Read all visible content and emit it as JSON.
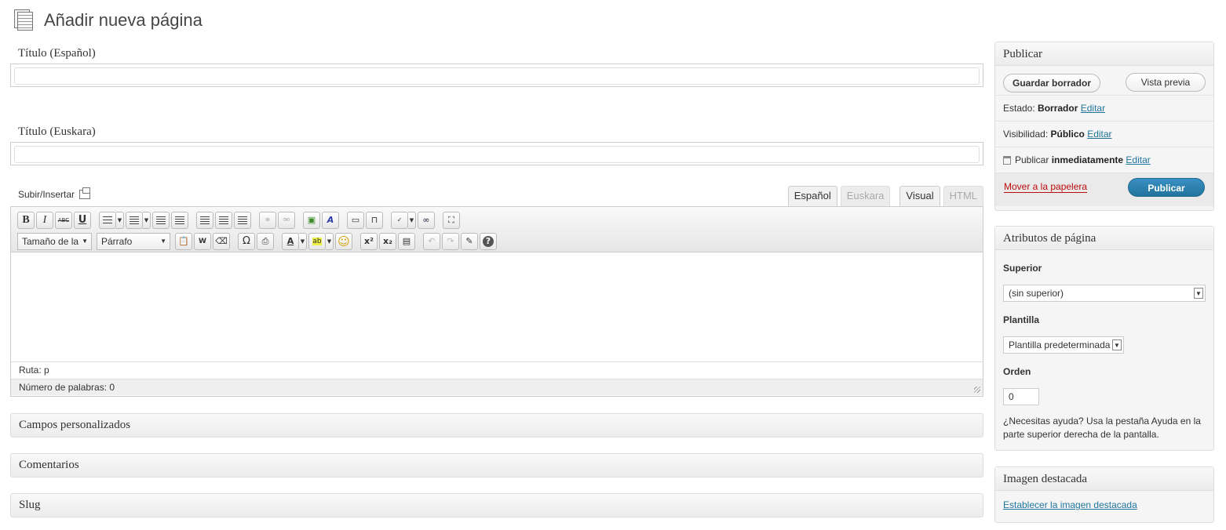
{
  "page": {
    "title": "Añadir nueva página"
  },
  "titles": [
    {
      "label": "Título (Español)",
      "value": ""
    },
    {
      "label": "Título (Euskara)",
      "value": ""
    }
  ],
  "editor": {
    "upload_label": "Subir/Insertar",
    "lang_tabs": [
      "Español",
      "Euskara"
    ],
    "mode_tabs": [
      "Visual",
      "HTML"
    ],
    "font_size_select": "Tamaño de la",
    "format_select": "Párrafo",
    "path_label": "Ruta: ",
    "path_value": "p",
    "word_count": "Número de palabras: 0",
    "toolbar_row1": [
      "B",
      "I",
      "ABC",
      "U"
    ],
    "special_glyphs": {
      "omega": "Ω",
      "sup": "x²",
      "sub": "x₂",
      "help": "?",
      "smiley": "☺"
    }
  },
  "meta_boxes": [
    "Campos personalizados",
    "Comentarios",
    "Slug"
  ],
  "publish": {
    "title": "Publicar",
    "save_draft": "Guardar borrador",
    "preview": "Vista previa",
    "status_label": "Estado:",
    "status_value": "Borrador",
    "visibility_label": "Visibilidad:",
    "visibility_value": "Público",
    "schedule_label": "Publicar",
    "schedule_value": "inmediatamente",
    "edit": "Editar",
    "trash": "Mover a la papelera",
    "publish_button": "Publicar"
  },
  "attributes": {
    "title": "Atributos de página",
    "parent_label": "Superior",
    "parent_value": "(sin superior)",
    "template_label": "Plantilla",
    "template_value": "Plantilla predeterminada",
    "order_label": "Orden",
    "order_value": "0",
    "help": "¿Necesitas ayuda? Usa la pestaña Ayuda en la parte superior derecha de la pantalla."
  },
  "featured": {
    "title": "Imagen destacada",
    "link": "Establecer la imagen destacada"
  }
}
